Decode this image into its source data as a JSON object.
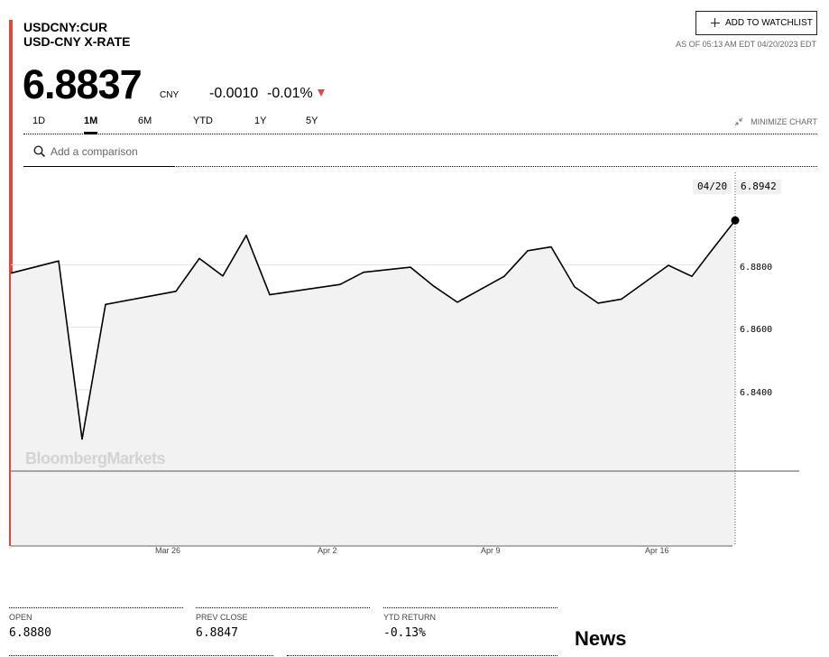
{
  "header": {
    "ticker": "USDCNY:CUR",
    "name": "USD-CNY X-RATE",
    "price": "6.8837",
    "currency": "CNY",
    "change": "-0.0010",
    "change_pct": "-0.01%",
    "watchlist_label": "ADD TO WATCHLIST",
    "as_of": "AS OF 05:13 AM EDT 04/20/2023 EDT",
    "down_color": "#e0473f"
  },
  "tabs": [
    "1D",
    "1M",
    "6M",
    "YTD",
    "1Y",
    "5Y"
  ],
  "active_tab": "1M",
  "minimize_label": "MINIMIZE CHART",
  "compare": {
    "placeholder": "Add a comparison"
  },
  "chart_data": {
    "type": "area",
    "x": [
      "03/20",
      "03/21",
      "03/22",
      "03/23",
      "03/24",
      "03/27",
      "03/28",
      "03/29",
      "03/30",
      "03/31",
      "04/03",
      "04/04",
      "04/05",
      "04/06",
      "04/07",
      "04/10",
      "04/11",
      "04/12",
      "04/13",
      "04/14",
      "04/17",
      "04/18",
      "04/19",
      "04/20"
    ],
    "series": [
      {
        "values": [
          6.8773,
          6.8812,
          6.8242,
          6.8673,
          6.8715,
          6.882,
          6.8764,
          6.8894,
          6.8704,
          6.8737,
          6.8776,
          6.8792,
          6.8731,
          6.868,
          6.8763,
          6.8845,
          6.8857,
          6.8729,
          6.8677,
          6.869,
          6.8798,
          6.8763,
          6.8846,
          6.8942
        ]
      }
    ],
    "yticks": [
      "6.8800",
      "6.8600",
      "6.8400"
    ],
    "xticks": [
      "Mar 26",
      "Apr 2",
      "Apr 9",
      "Apr 16"
    ],
    "ylim": [
      6.79,
      6.911
    ],
    "last_date": "04/20",
    "last_value": "6.8942",
    "prev_close": 6.8847,
    "watermark": "BloombergMarkets"
  },
  "stats": [
    {
      "label": "OPEN",
      "value": "6.8880"
    },
    {
      "label": "PREV CLOSE",
      "value": "6.8847"
    },
    {
      "label": "YTD RETURN",
      "value": "-0.13%"
    }
  ],
  "news_title": "News"
}
